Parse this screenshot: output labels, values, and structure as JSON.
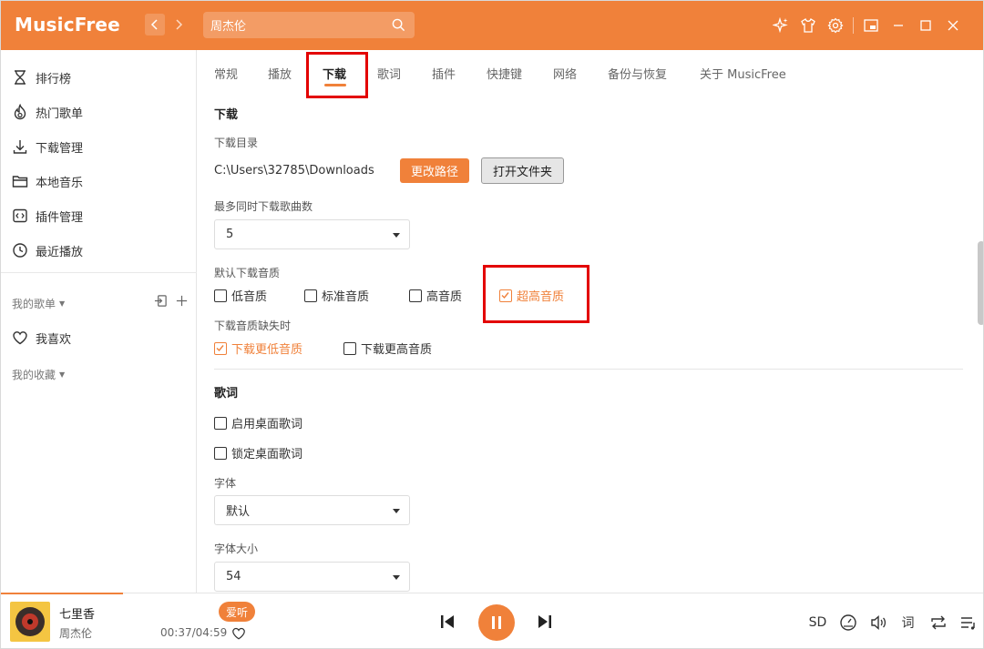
{
  "app": {
    "title": "MusicFree"
  },
  "search": {
    "value": "周杰伦"
  },
  "colors": {
    "accent": "#f0813a",
    "highlight": "#e30000"
  },
  "sidebar": {
    "items": [
      {
        "label": "排行榜",
        "icon": "hourglass-icon"
      },
      {
        "label": "热门歌单",
        "icon": "fire-icon"
      },
      {
        "label": "下载管理",
        "icon": "download-icon"
      },
      {
        "label": "本地音乐",
        "icon": "folder-icon"
      },
      {
        "label": "插件管理",
        "icon": "plugin-icon"
      },
      {
        "label": "最近播放",
        "icon": "clock-icon"
      }
    ],
    "my_playlists": "我的歌单",
    "favorites": "我喜欢",
    "my_collections": "我的收藏"
  },
  "tabs": [
    "常规",
    "播放",
    "下载",
    "歌词",
    "插件",
    "快捷键",
    "网络",
    "备份与恢复",
    "关于 MusicFree"
  ],
  "active_tab": "下载",
  "download": {
    "section_title": "下载",
    "dir_label": "下载目录",
    "dir_path": "C:\\Users\\32785\\Downloads",
    "change_path_button": "更改路径",
    "open_folder_button": "打开文件夹",
    "max_concurrent_label": "最多同时下载歌曲数",
    "max_concurrent_value": "5",
    "default_quality_label": "默认下载音质",
    "qualities": [
      {
        "label": "低音质",
        "checked": false
      },
      {
        "label": "标准音质",
        "checked": false
      },
      {
        "label": "高音质",
        "checked": false
      },
      {
        "label": "超高音质",
        "checked": true
      }
    ],
    "missing_quality_label": "下载音质缺失时",
    "fallback_options": [
      {
        "label": "下载更低音质",
        "checked": true
      },
      {
        "label": "下载更高音质",
        "checked": false
      }
    ]
  },
  "lyrics": {
    "section_title": "歌词",
    "enable_desktop": "启用桌面歌词",
    "lock_desktop": "锁定桌面歌词",
    "font_label": "字体",
    "font_value": "默认",
    "font_size_label": "字体大小",
    "font_size_value": "54"
  },
  "player": {
    "song": "七里香",
    "artist": "周杰伦",
    "badge": "爱听",
    "time": "00:37/04:59",
    "progress": 0.124,
    "quality": "SD",
    "lyric_button": "词"
  }
}
